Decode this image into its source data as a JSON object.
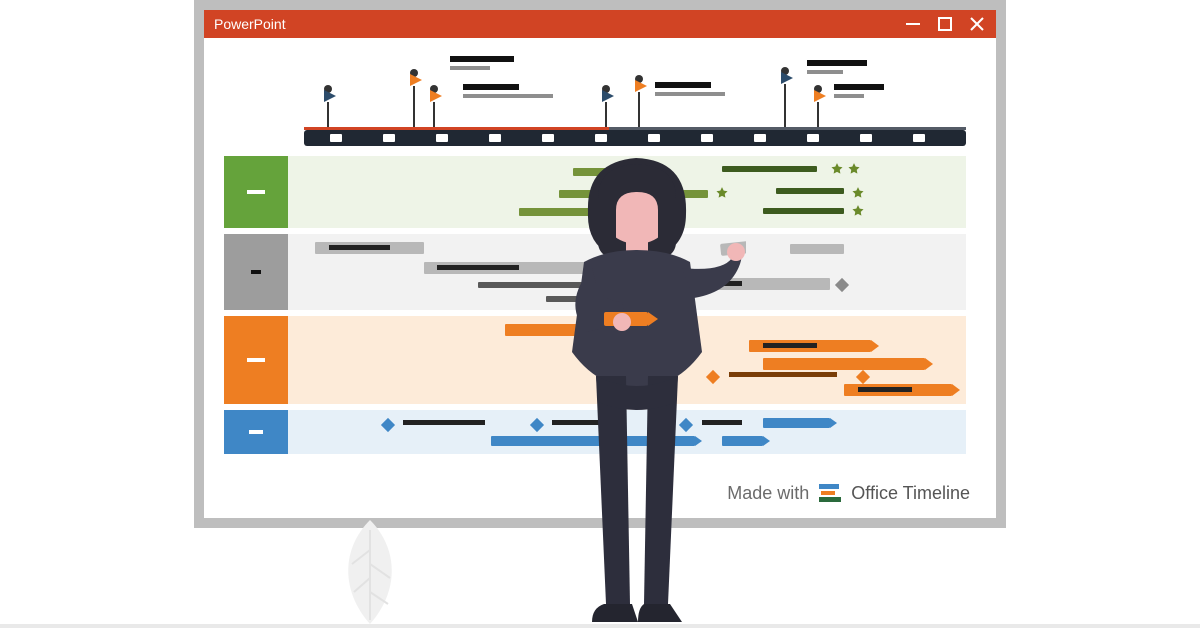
{
  "window": {
    "title": "PowerPoint"
  },
  "brand": {
    "prefix": "Made with",
    "name": "Office Timeline"
  },
  "colors": {
    "titlebar": "#d14424",
    "swimlanes": {
      "green": "#65a33b",
      "gray": "#9d9d9d",
      "orange": "#ee7e22",
      "blue": "#3f87c6"
    }
  },
  "timeline": {
    "tick_count": 13,
    "milestone_flags": [
      {
        "x_pct": 3,
        "color": "blue"
      },
      {
        "x_pct": 16,
        "color": "orange"
      },
      {
        "x_pct": 19,
        "color": "orange"
      },
      {
        "x_pct": 45,
        "color": "blue"
      },
      {
        "x_pct": 50,
        "color": "orange"
      },
      {
        "x_pct": 72,
        "color": "blue"
      },
      {
        "x_pct": 77,
        "color": "orange"
      }
    ]
  },
  "swimlanes": [
    {
      "id": "green",
      "label_style": "dash"
    },
    {
      "id": "gray",
      "label_style": "dot"
    },
    {
      "id": "orange",
      "label_style": "dash"
    },
    {
      "id": "blue",
      "label_style": "dash"
    }
  ]
}
